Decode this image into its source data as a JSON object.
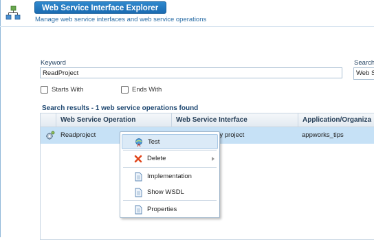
{
  "header": {
    "title": "Web Service Interface Explorer",
    "subtitle": "Manage web service interfaces and web service operations",
    "app_icon": "sitemap-icon"
  },
  "form": {
    "keyword_label": "Keyword",
    "keyword_value": "ReadProject",
    "search_label": "Search",
    "search_value": "Web S",
    "starts_with_label": "Starts With",
    "ends_with_label": "Ends With"
  },
  "results": {
    "title": "Search results - 1 web service operations found",
    "columns": [
      "Web Service Operation",
      "Web Service Interface",
      "Application/Organiza"
    ],
    "rows": [
      {
        "operation": "Readproject",
        "interface": "tity project",
        "application": "appworks_tips",
        "icon": "gear-operation-icon"
      }
    ]
  },
  "context_menu": {
    "items": [
      {
        "label": "Test",
        "icon": "test-run-icon"
      },
      {
        "label": "Delete",
        "icon": "delete-x-icon"
      },
      {
        "label": "Implementation",
        "icon": "document-icon"
      },
      {
        "label": "Show WSDL",
        "icon": "document-icon"
      },
      {
        "label": "Properties",
        "icon": "document-icon"
      }
    ]
  },
  "colors": {
    "title_bar": "#1b6cb2",
    "selected_row": "#c6e1f6",
    "delete_icon": "#e0451b"
  }
}
